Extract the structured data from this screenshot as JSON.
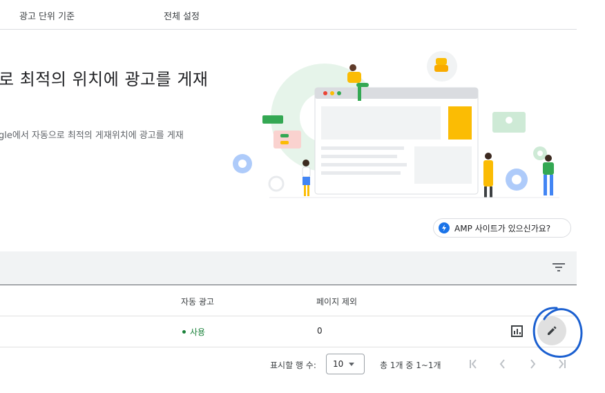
{
  "tabs": [
    {
      "label": "광고 단위 기준"
    },
    {
      "label": "전체 설정"
    }
  ],
  "hero": {
    "headline": "로 최적의 위치에 광고를 게재",
    "description": "gle에서 자동으로 최적의 게재위치에 광고를 게재"
  },
  "amp_chip": {
    "label": "AMP 사이트가 있으신가요?"
  },
  "table": {
    "columns": [
      "자동 광고",
      "페이지 제외"
    ],
    "rows": [
      {
        "auto_ads": "사용",
        "excluded_pages": "0"
      }
    ]
  },
  "pagination": {
    "rows_label": "표시할 행 수:",
    "rows_value": "10",
    "range_text": "총 1개 중 1~1개"
  },
  "colors": {
    "accent": "#1a73e8",
    "status_green": "#188038",
    "annotation_circle": "#1a5fd0"
  }
}
